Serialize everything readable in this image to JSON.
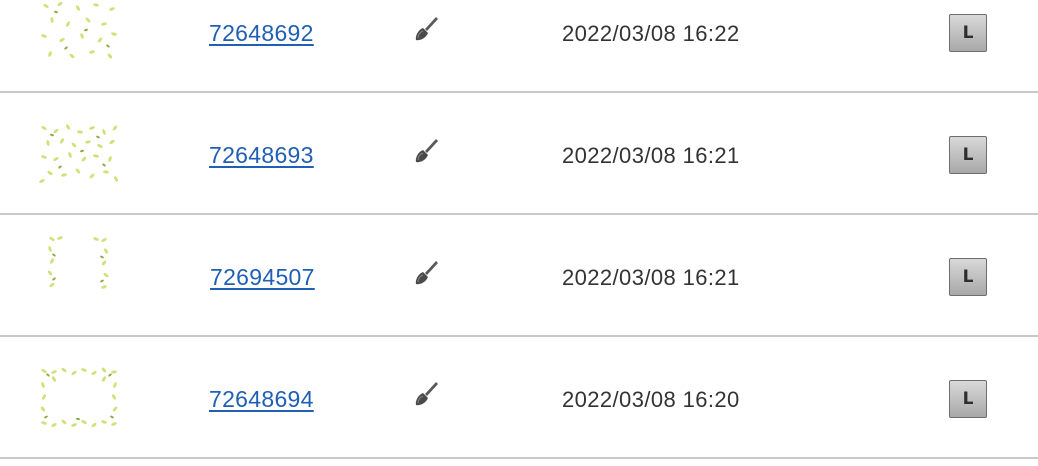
{
  "rows": [
    {
      "id": "72648692",
      "date": "2022/03/08 16:22",
      "thumb": "leaf-scatter-sparse",
      "button_label": "L"
    },
    {
      "id": "72648693",
      "date": "2022/03/08 16:21",
      "thumb": "leaf-scatter-dense",
      "button_label": "L"
    },
    {
      "id": "72694507",
      "date": "2022/03/08 16:21",
      "thumb": "leaf-arch-frame",
      "button_label": "L"
    },
    {
      "id": "72648694",
      "date": "2022/03/08 16:20",
      "thumb": "leaf-rect-frame",
      "button_label": "L"
    }
  ],
  "icons": {
    "edit": "brush-icon"
  },
  "colors": {
    "link": "#1f5fb4",
    "text": "#333333",
    "divider": "#c9c9c9",
    "leaf_light": "#cfe27a",
    "leaf_dark": "#7fae3e"
  }
}
